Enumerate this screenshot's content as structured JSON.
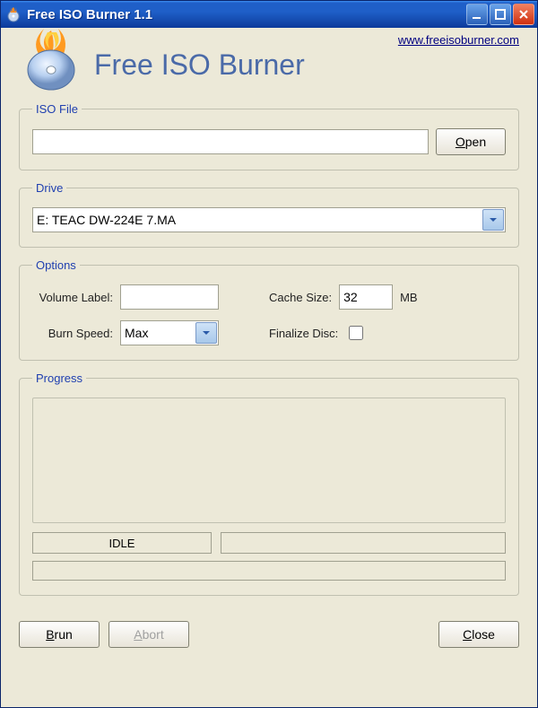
{
  "titlebar": {
    "title": "Free ISO Burner 1.1"
  },
  "header": {
    "url": "www.freeisoburner.com",
    "app_title": "Free ISO Burner"
  },
  "iso": {
    "legend": "ISO File",
    "value": "",
    "open_label": "Open"
  },
  "drive": {
    "legend": "Drive",
    "selected": "E: TEAC    DW-224E         7.MA"
  },
  "options": {
    "legend": "Options",
    "volume_label_label": "Volume Label:",
    "volume_label_value": "",
    "cache_size_label": "Cache Size:",
    "cache_size_value": "32",
    "cache_size_unit": "MB",
    "burn_speed_label": "Burn Speed:",
    "burn_speed_value": "Max",
    "finalize_label": "Finalize Disc:",
    "finalize_checked": false
  },
  "progress": {
    "legend": "Progress",
    "status": "IDLE"
  },
  "footer": {
    "brun_label": "Brun",
    "abort_label": "Abort",
    "close_label": "Close"
  }
}
